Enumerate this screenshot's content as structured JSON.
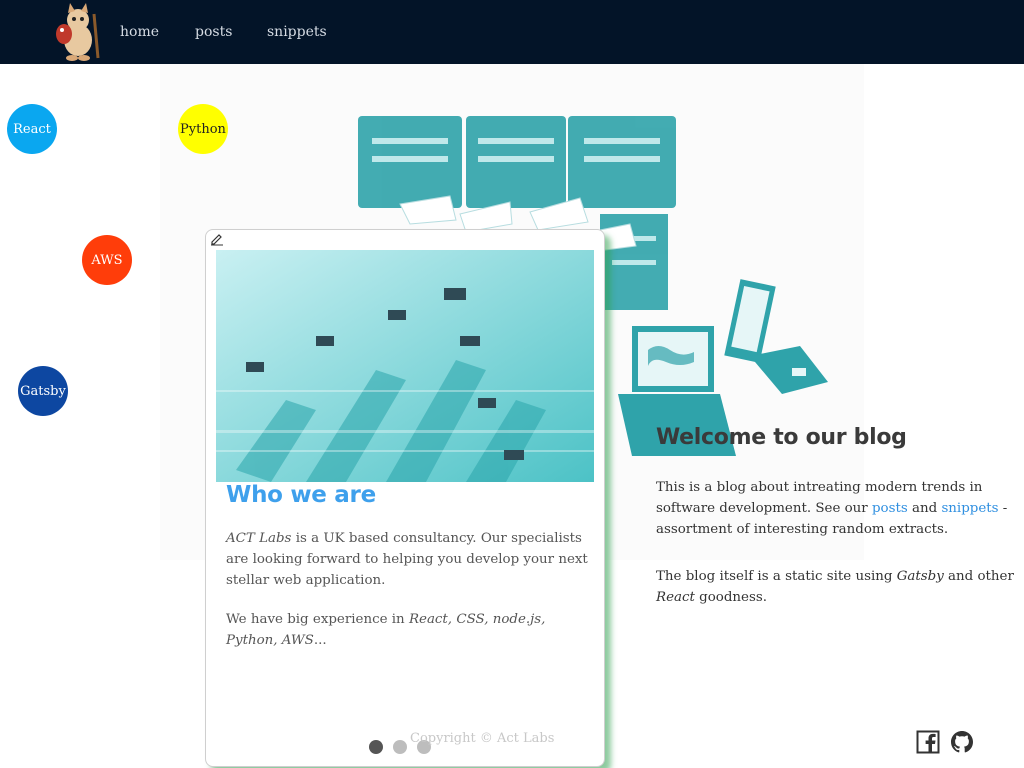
{
  "nav": {
    "links": [
      "home",
      "posts",
      "snippets"
    ]
  },
  "bubbles": [
    {
      "label": "React",
      "bg": "#0aa7f0",
      "fg": "#ffffff"
    },
    {
      "label": "Python",
      "bg": "#ffff00",
      "fg": "#222222"
    },
    {
      "label": "AWS",
      "bg": "#ff3d0a",
      "fg": "#ffffff"
    },
    {
      "label": "Gatsby",
      "bg": "#0d47a1",
      "fg": "#ffffff"
    }
  ],
  "card": {
    "title": "Who we are",
    "p1_em": "ACT Labs",
    "p1_rest": " is a UK based consultancy. Our specialists are looking forward to helping you develop your next stellar web application.",
    "p2_lead": "We have big experience in ",
    "p2_em": "React, CSS, node.js, Python, AWS",
    "p2_tail": "...",
    "dots": 3,
    "active_dot": 0
  },
  "welcome": {
    "title": "Welcome to our blog",
    "p1_a": "This is a blog about intreating modern trends in software development. See our ",
    "posts_link": "posts",
    "p1_b": " and ",
    "snippets_link": "snippets",
    "p1_c": " - assortment of interesting random extracts.",
    "p2_a": "The blog itself is a static site using ",
    "p2_em1": "Gatsby",
    "p2_b": " and other ",
    "p2_em2": "React",
    "p2_c": " goodness."
  },
  "footer": {
    "copyright": "Copyright © Act Labs"
  },
  "icons": {
    "logo": "cat-mascot-icon",
    "edit": "pencil-icon",
    "facebook": "facebook-icon",
    "github": "github-icon"
  },
  "colors": {
    "nav_bg": "#031428",
    "accent": "#3ea0ec",
    "link": "#2f8fe0",
    "card_shadow": "#32a050"
  }
}
